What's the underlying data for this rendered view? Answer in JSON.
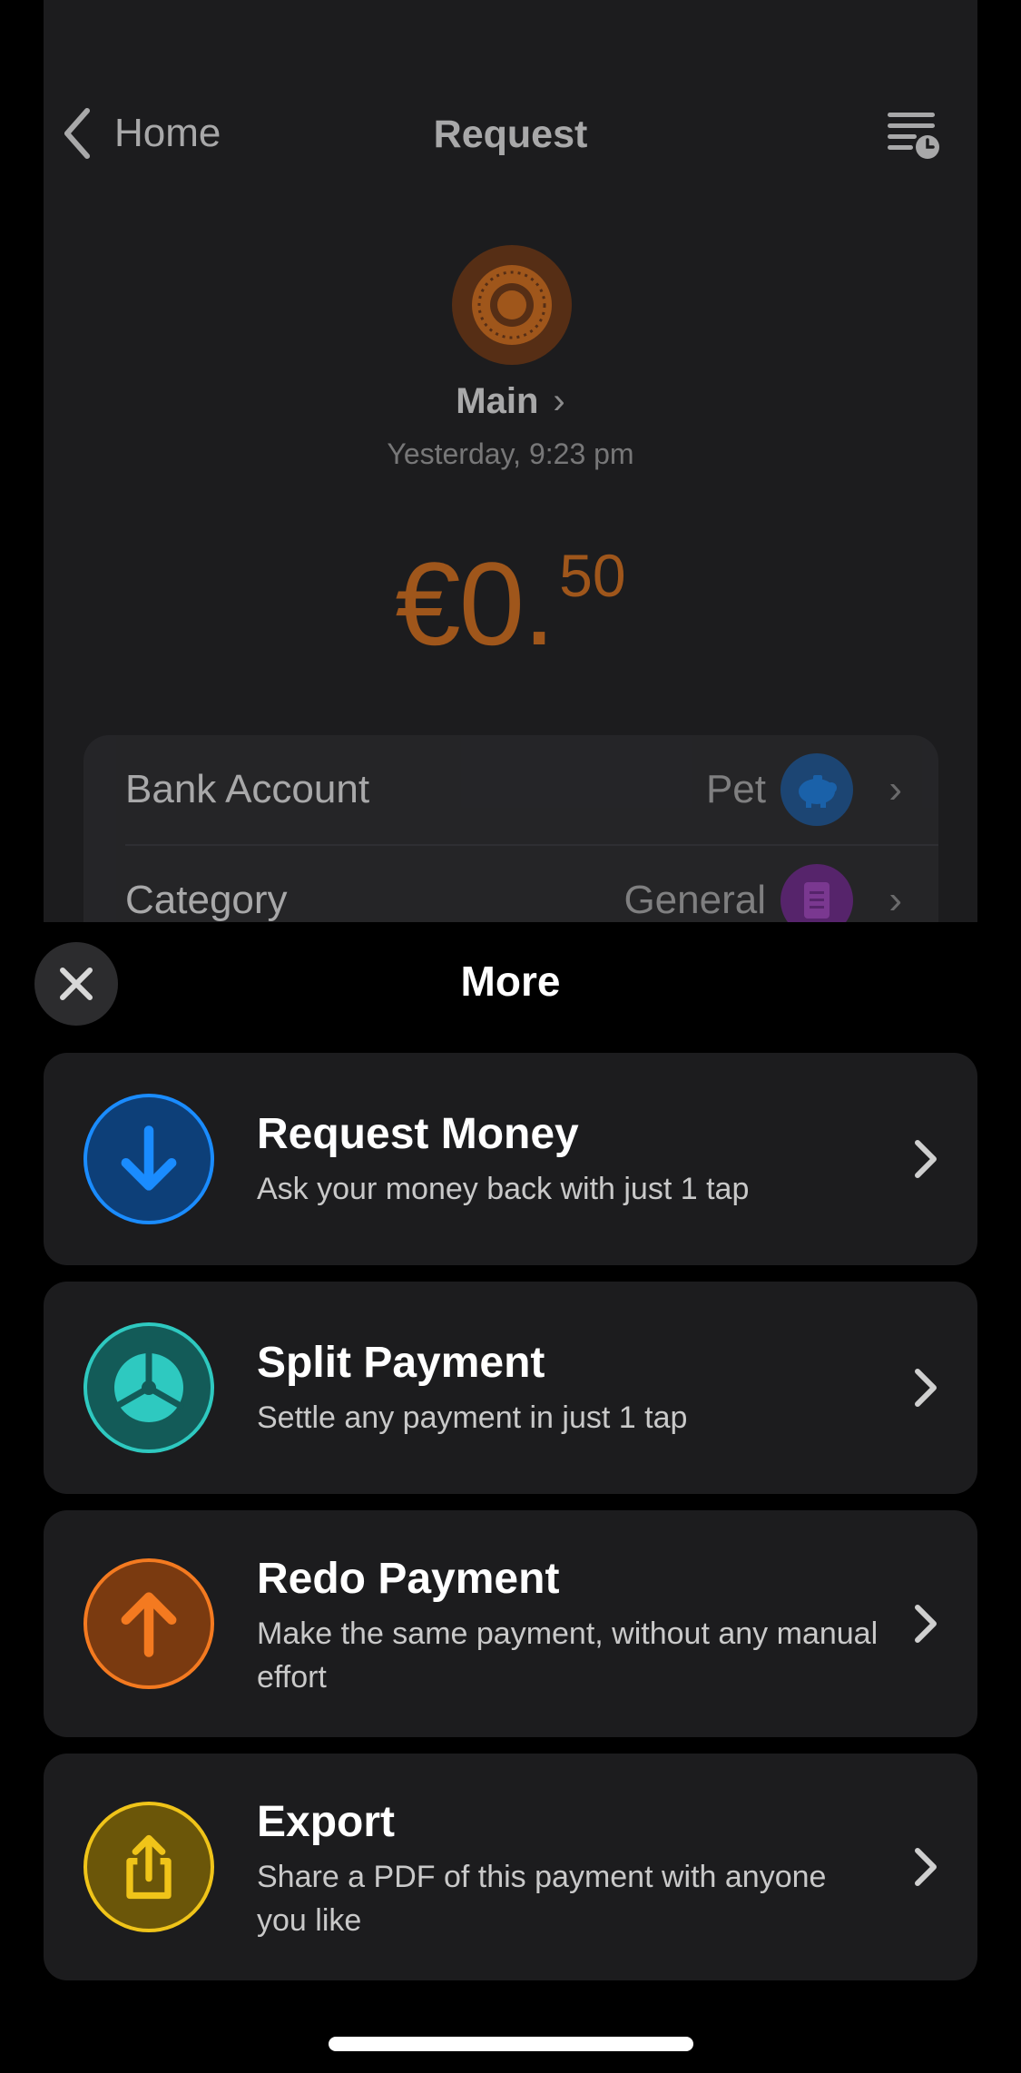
{
  "app": {
    "nav": {
      "back_label": "Home",
      "title": "Request",
      "history_icon": "history-list-icon"
    },
    "account": {
      "name": "Main",
      "timestamp": "Yesterday, 9:23 pm"
    },
    "amount": {
      "main": "€0.",
      "cents": "50",
      "color": "#f07a1a"
    },
    "details": [
      {
        "label": "Bank Account",
        "value": "Pet",
        "icon": "piggy-bank-icon",
        "icon_color": "#1d5fa8"
      },
      {
        "label": "Category",
        "value": "General",
        "icon": "document-icon",
        "icon_color": "#7a2a9a"
      }
    ]
  },
  "sheet": {
    "title": "More",
    "close_icon": "close-icon",
    "options": [
      {
        "title": "Request Money",
        "subtitle": "Ask your money back with just 1 tap",
        "icon": "arrow-down-icon",
        "color": "#1a8cff"
      },
      {
        "title": "Split Payment",
        "subtitle": "Settle any payment in just 1 tap",
        "icon": "pie-split-icon",
        "color": "#2ec9c0"
      },
      {
        "title": "Redo Payment",
        "subtitle": "Make the same payment, without any manual effort",
        "icon": "arrow-up-icon",
        "color": "#f47a20"
      },
      {
        "title": "Export",
        "subtitle": "Share a PDF of this payment with anyone you like",
        "icon": "share-icon",
        "color": "#f0c419"
      }
    ]
  }
}
